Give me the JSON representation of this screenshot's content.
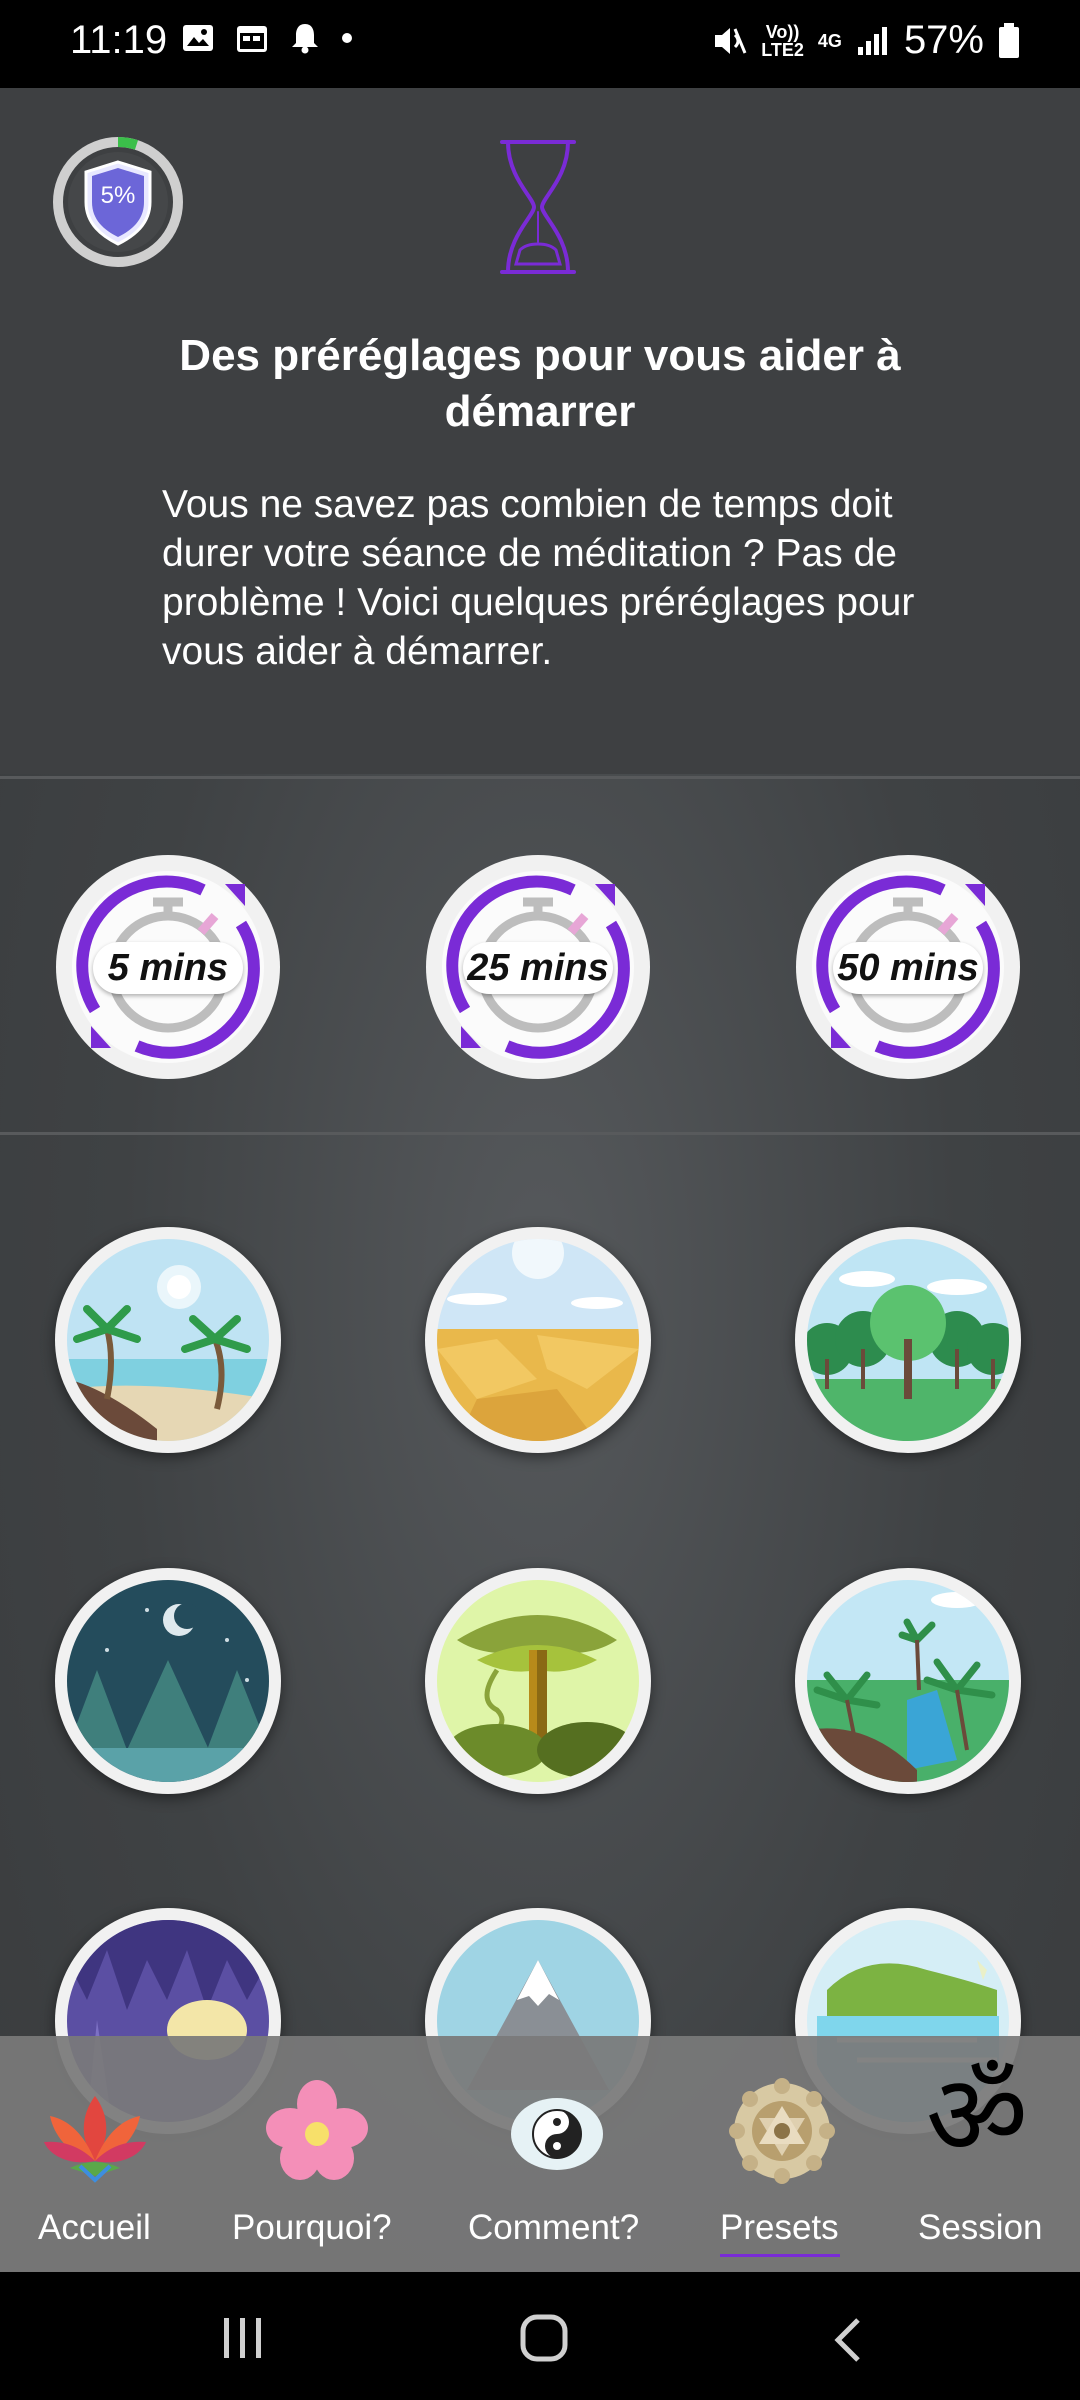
{
  "status_bar": {
    "time": "11:19",
    "network_volte": "Vo))\nLTE2",
    "network_4g": "4G",
    "battery": "57%"
  },
  "header": {
    "progress_value": "5%",
    "title": "Des préréglages pour vous aider à démarrer",
    "description": "Vous ne savez pas combien de temps doit durer votre séance de méditation ? Pas de problème ! Voici quelques préréglages pour vous aider à démarrer."
  },
  "timers": [
    {
      "label": "5 mins"
    },
    {
      "label": "25 mins"
    },
    {
      "label": "50 mins"
    }
  ],
  "scenes": [
    {
      "icon": "beach-scene-icon"
    },
    {
      "icon": "desert-scene-icon"
    },
    {
      "icon": "forest-scene-icon"
    },
    {
      "icon": "night-forest-scene-icon"
    },
    {
      "icon": "jungle-tree-scene-icon"
    },
    {
      "icon": "tropical-scene-icon"
    },
    {
      "icon": "cave-scene-icon"
    },
    {
      "icon": "mountain-scene-icon"
    },
    {
      "icon": "waterfall-scene-icon"
    }
  ],
  "nav": {
    "items": [
      {
        "label": "Accueil",
        "icon": "lotus-icon"
      },
      {
        "label": "Pourquoi?",
        "icon": "flower-icon"
      },
      {
        "label": "Comment?",
        "icon": "yin-yang-icon"
      },
      {
        "label": "Presets",
        "icon": "mandala-icon",
        "active": true
      },
      {
        "label": "Session",
        "icon": "om-icon"
      }
    ]
  },
  "colors": {
    "accent": "#7a2bd6",
    "background": "#3e4042",
    "nav_bg": "#7a7a7a"
  }
}
